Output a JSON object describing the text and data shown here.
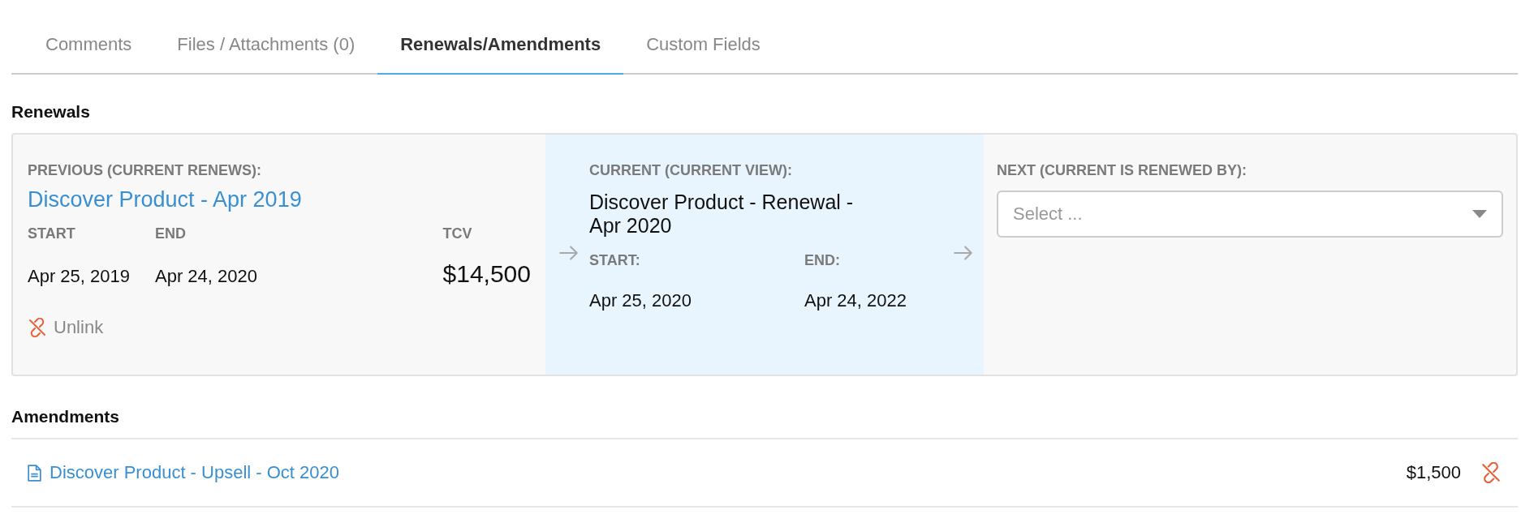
{
  "tabs": [
    {
      "label": "Comments",
      "selected": false
    },
    {
      "label": "Files / Attachments (0)",
      "selected": false
    },
    {
      "label": "Renewals/Amendments",
      "selected": true
    },
    {
      "label": "Custom Fields",
      "selected": false
    }
  ],
  "renewals": {
    "title": "Renewals",
    "previous": {
      "label": "PREVIOUS (CURRENT RENEWS):",
      "link": "Discover Product - Apr 2019",
      "start_label": "START",
      "end_label": "END",
      "tcv_label": "TCV",
      "start": "Apr 25, 2019",
      "end": "Apr 24, 2020",
      "tcv": "$14,500",
      "unlink": "Unlink"
    },
    "current": {
      "label": "CURRENT (CURRENT VIEW):",
      "title": "Discover Product - Renewal - Apr 2020",
      "start_label": "START:",
      "end_label": "END:",
      "start": "Apr 25, 2020",
      "end": "Apr 24, 2022"
    },
    "next": {
      "label": "NEXT (CURRENT IS RENEWED BY):",
      "placeholder": "Select ..."
    }
  },
  "amendments": {
    "title": "Amendments",
    "items": [
      {
        "title": "Discover Product - Upsell - Oct 2020",
        "amount": "$1,500"
      }
    ]
  }
}
